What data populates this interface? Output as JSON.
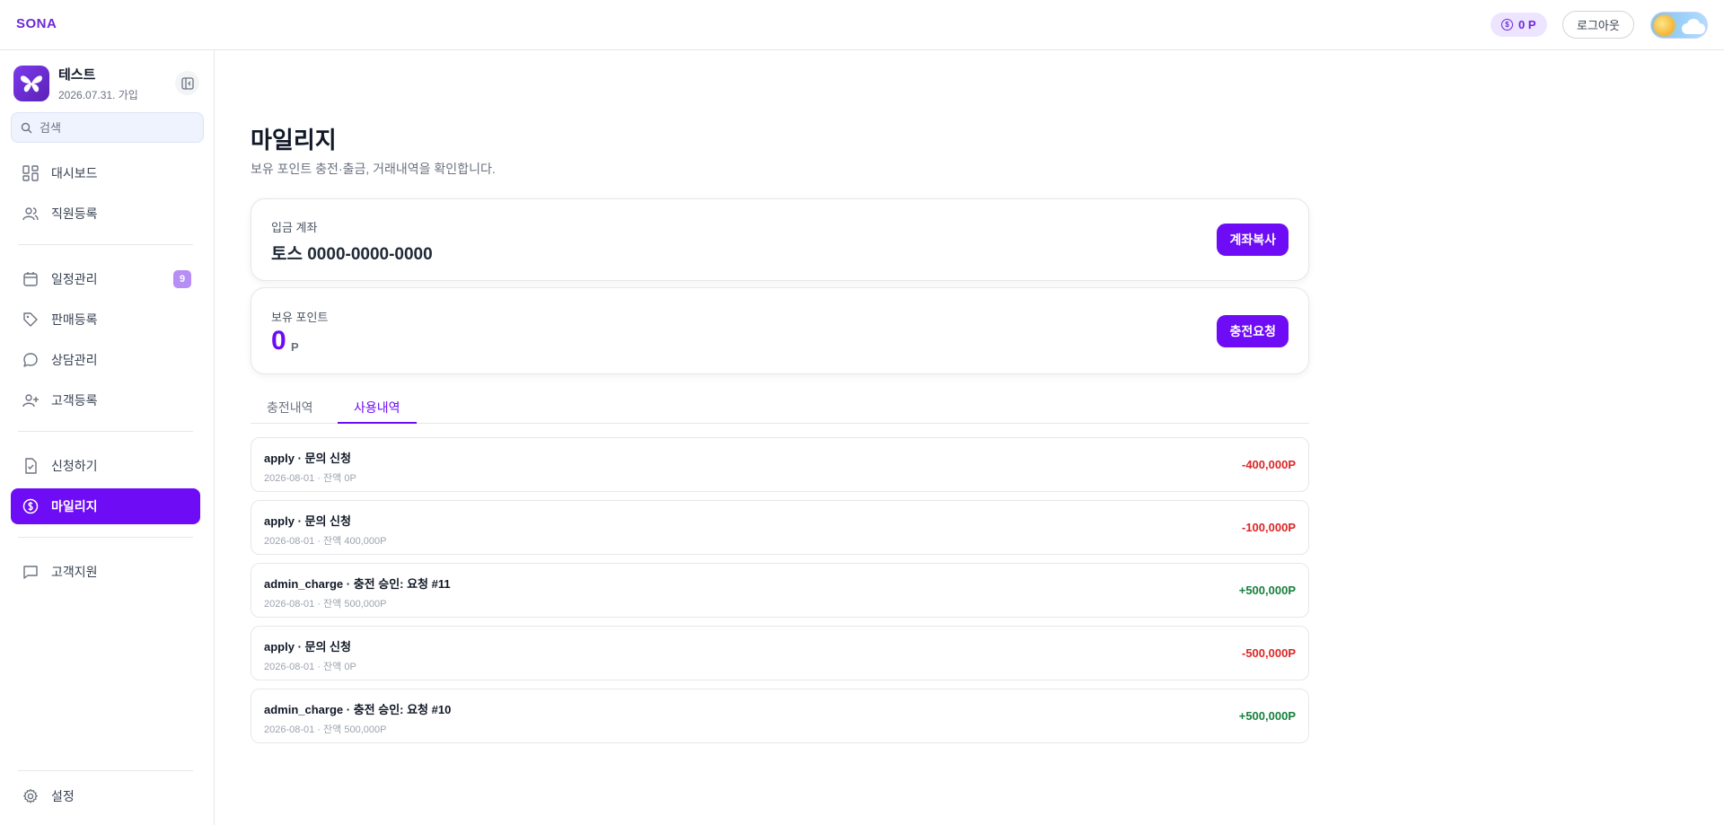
{
  "app": {
    "brand": "SONA"
  },
  "header": {
    "points": "0 P",
    "points_icon": "coin-icon",
    "logout_label": "로그아웃"
  },
  "sidebar": {
    "profile": {
      "name": "테스트",
      "joined": "2026.07.31. 가입"
    },
    "search_placeholder": "검색",
    "items": [
      {
        "label": "대시보드",
        "icon": "dashboard-icon"
      },
      {
        "label": "직원등록",
        "icon": "users-icon"
      },
      {
        "label": "일정관리",
        "icon": "calendar-icon",
        "badge": "9"
      },
      {
        "label": "판매등록",
        "icon": "tag-icon"
      },
      {
        "label": "상담관리",
        "icon": "chat-icon"
      },
      {
        "label": "고객등록",
        "icon": "user-plus-icon"
      },
      {
        "label": "신청하기",
        "icon": "file-check-icon"
      },
      {
        "label": "마일리지",
        "icon": "coin-icon",
        "active": true
      },
      {
        "label": "고객지원",
        "icon": "message-square-icon"
      }
    ],
    "settings_label": "설정"
  },
  "main": {
    "title": "마일리지",
    "description": "보유 포인트 충전·출금, 거래내역을 확인합니다.",
    "account_card": {
      "label": "입금 계좌",
      "value": "토스 0000-0000-0000",
      "button": "계좌복사"
    },
    "points_card": {
      "label": "보유 포인트",
      "value": "0",
      "unit": "P",
      "button": "충전요청"
    },
    "tabs": [
      {
        "label": "충전내역",
        "active": false
      },
      {
        "label": "사용내역",
        "active": true
      }
    ],
    "transactions": [
      {
        "title": "apply · 문의 신청",
        "sub": "2026-08-01 · 잔액 0P",
        "amount": "-400,000P",
        "type": "neg"
      },
      {
        "title": "apply · 문의 신청",
        "sub": "2026-08-01 · 잔액 400,000P",
        "amount": "-100,000P",
        "type": "neg"
      },
      {
        "title": "admin_charge · 충전 승인: 요청 #11",
        "sub": "2026-08-01 · 잔액 500,000P",
        "amount": "+500,000P",
        "type": "pos"
      },
      {
        "title": "apply · 문의 신청",
        "sub": "2026-08-01 · 잔액 0P",
        "amount": "-500,000P",
        "type": "neg"
      },
      {
        "title": "admin_charge · 충전 승인: 요청 #10",
        "sub": "2026-08-01 · 잔액 500,000P",
        "amount": "+500,000P",
        "type": "pos"
      }
    ]
  },
  "colors": {
    "accent": "#6d0cf5",
    "negative": "#dc2626",
    "positive": "#15803d"
  }
}
